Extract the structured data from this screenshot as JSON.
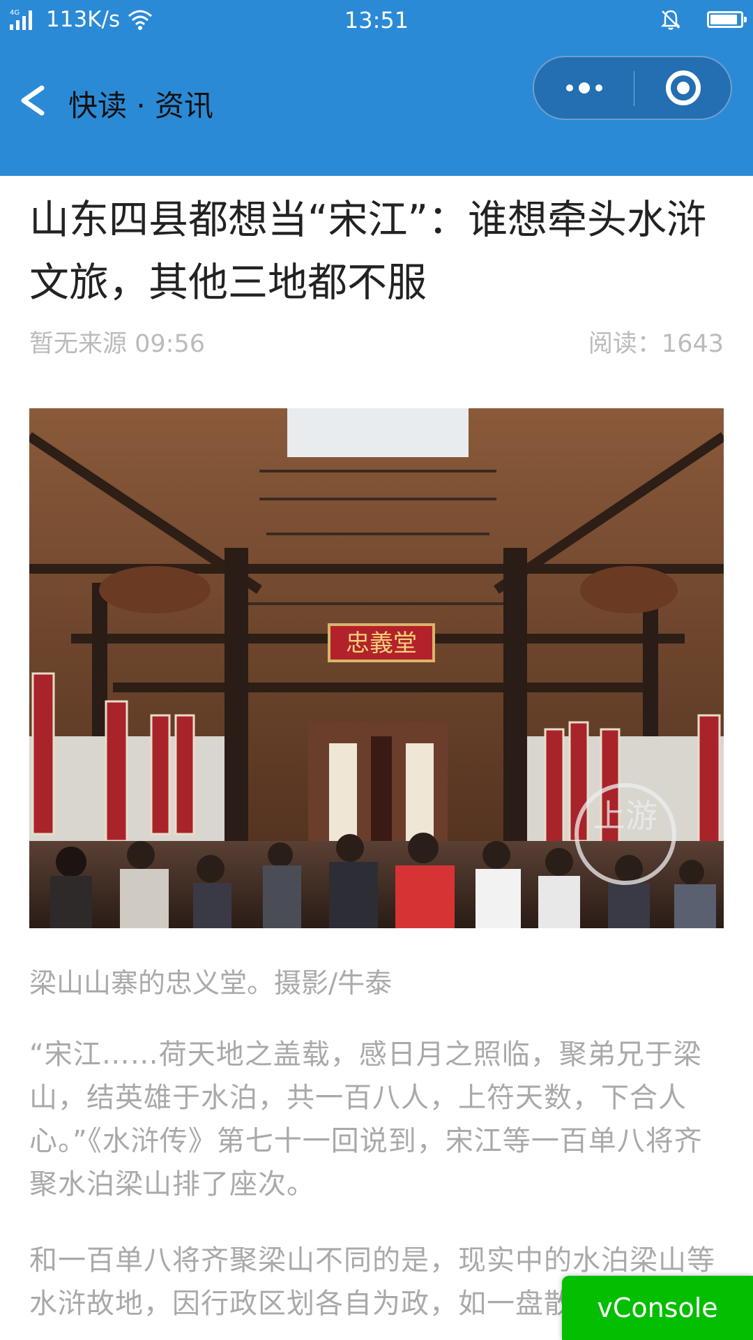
{
  "status_bar": {
    "network": "4G",
    "speed": "113K/s",
    "time": "13:51"
  },
  "header": {
    "back_icon": "chevron-left-icon",
    "title": "快读 · 资讯",
    "more_icon": "more-dots-icon",
    "close_icon": "target-circle-icon",
    "color": "#2a8ad6"
  },
  "article": {
    "title": "山东四县都想当“宋江”：谁想牵头水浒文旅，其他三地都不服",
    "source_time": "暂无来源 09:56",
    "reads": "阅读：1643",
    "photo": {
      "plaque_text": "忠義堂",
      "watermark": "上游",
      "alt_icon": "photo-hall-image"
    },
    "caption": "梁山山寨的忠义堂。摄影/牛泰",
    "paragraphs": [
      "“宋江……荷天地之盖载，感日月之照临，聚弟兄于梁山，结英雄于水泊，共一百八人，上符天数，下合人心。”《水浒传》第七十一回说到，宋江等一百单八将齐聚水泊梁山排了座次。",
      "和一百单八将齐聚梁山不同的是，现实中的水泊梁山等水浒故地，因行政区划各自为政，如一盘散沙。"
    ]
  },
  "vconsole": {
    "label": "vConsole",
    "color": "#04be02"
  }
}
